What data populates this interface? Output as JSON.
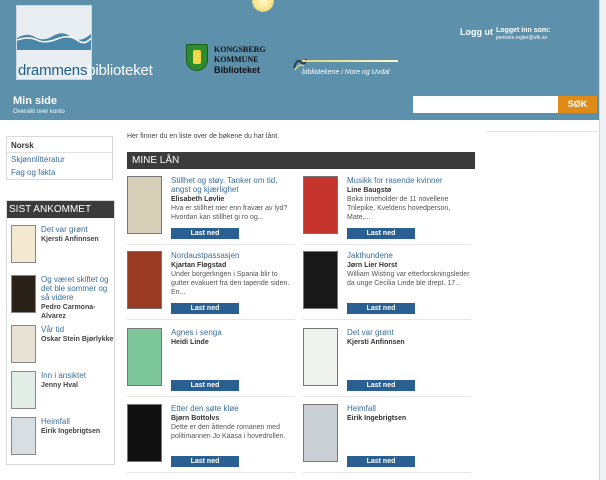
{
  "header": {
    "logo_part1": "drammens",
    "logo_part2": "biblioteket",
    "kongsberg_line1": "KONGSBERG",
    "kongsberg_line2": "KOMMUNE",
    "kongsberg_line3": "Biblioteket",
    "nore_text": "bibliotekene i Nore og Uvdal",
    "login_label": "Logg ut",
    "logged_in_label": "Logget inn som:",
    "logged_in_user": "jannicke.rogler@ofk.no",
    "page_title": "Min side",
    "page_subtitle": "Oversikt over konto",
    "search_placeholder": "",
    "search_button": "SØK"
  },
  "sidebar": {
    "language": "Norsk",
    "links": [
      "Skjønnlitteratur",
      "Fag og fakta"
    ],
    "recent_heading": "SIST ANKOMMET",
    "recent": [
      {
        "title": "Det var grønt",
        "author": "Kjersti Anfinnsen"
      },
      {
        "title": "Og været skiftet og det ble sommer og så videre",
        "author": "Pedro Carmona-Alvarez"
      },
      {
        "title": "Vår tid",
        "author": "Oskar Stein Bjørlykke"
      },
      {
        "title": "Inn i ansiktet",
        "author": "Jenny Hval"
      },
      {
        "title": "Heimfall",
        "author": "Eirik Ingebrigtsen"
      }
    ]
  },
  "main": {
    "intro": "Her finner du en liste over de bøkene du har lånt.",
    "loans_heading": "MINE LÅN",
    "download_label": "Last ned",
    "loans": [
      {
        "title": "Stillhet og støy. Tanker om tid, angst og kjærlighet",
        "author": "Elisabeth Løvlie",
        "desc": "Hva er stillhet mer enn fravær av lyd? Hvordan kan stillhet gi ro og..."
      },
      {
        "title": "Musikk for rasende kvinner",
        "author": "Line Baugstø",
        "desc": "Boka inneholder de 11 novellene Trilepike, Kveldens hovedperson, Mate,..."
      },
      {
        "title": "Nordaustpassasjen",
        "author": "Kjartan Fløgstad",
        "desc": "Under borgerkrigen i Spania blir to gutter evakuert fra den tapende siden. En..."
      },
      {
        "title": "Jakthundene",
        "author": "Jørn Lier Horst",
        "desc": "William Wisting var etterforskningsleder da unge Cecilia Linde ble drept. 17..."
      },
      {
        "title": "Agnes i senga",
        "author": "Heidi Linde",
        "desc": ""
      },
      {
        "title": "Det var grønt",
        "author": "Kjersti Anfinnsen",
        "desc": ""
      },
      {
        "title": "Etter den søte kløe",
        "author": "Bjørn Bottolvs",
        "desc": "Dette er den åttende romanen med politimannen Jo Kaasa i hovedrollen."
      },
      {
        "title": "Heimfall",
        "author": "Eirik Ingebrigtsen",
        "desc": ""
      }
    ]
  },
  "colors": {
    "header_bg": "#5c90ab",
    "search_button": "#e08a18",
    "download_button": "#2a5f91",
    "link": "#3a6e9a",
    "heading_bar": "#3b3b3b"
  }
}
